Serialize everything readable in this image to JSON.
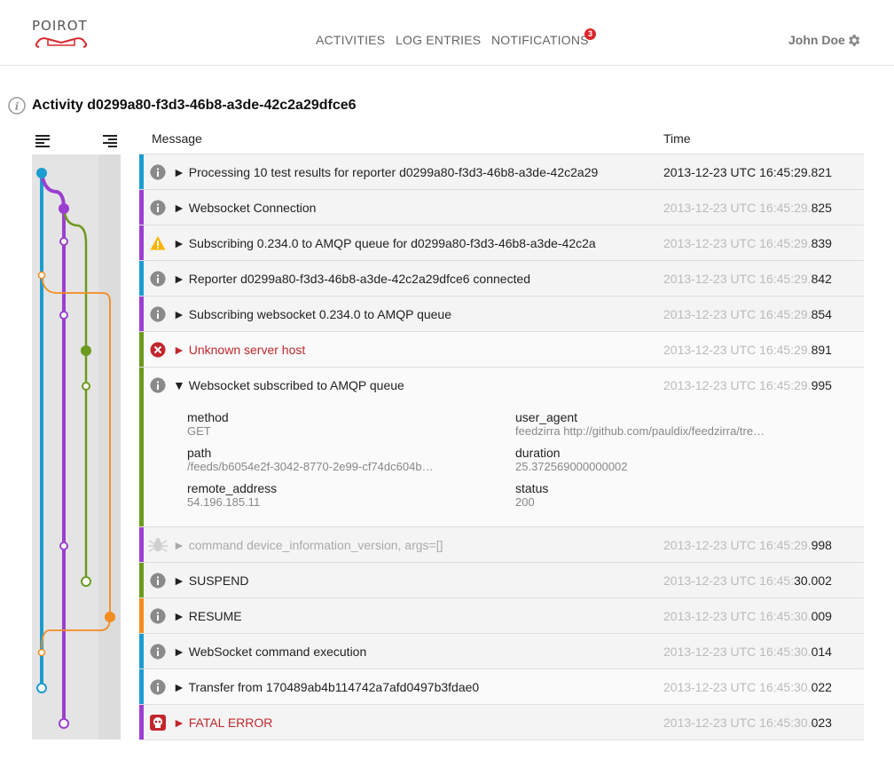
{
  "app": {
    "logo_text": "POIROT"
  },
  "nav": {
    "activities": "ACTIVITIES",
    "log_entries": "LOG ENTRIES",
    "notifications": "NOTIFICATIONS",
    "notifications_count": "3"
  },
  "user": {
    "name": "John Doe"
  },
  "page": {
    "title": "Activity d0299a80-f3d3-46b8-a3de-42c2a29dfce6"
  },
  "table": {
    "col_message": "Message",
    "col_time": "Time"
  },
  "colors": {
    "blue": "#1b9dd0",
    "purple": "#9b3fd0",
    "green": "#6c9a1e",
    "orange": "#f28c1e",
    "error": "#c1272d",
    "warning": "#f7b500"
  },
  "rows": [
    {
      "level": "info",
      "message": "► Processing 10 test results for reporter d0299a80-f3d3-46b8-a3de-42c2a29",
      "time_dim": "",
      "time_bold": "2013-12-23 UTC 16:45:29.821",
      "lane": "blue"
    },
    {
      "level": "info",
      "message": "► Websocket Connection",
      "time_dim": "2013-12-23 UTC 16:45:29.",
      "time_bold": "825",
      "lane": "purple"
    },
    {
      "level": "warning",
      "message": "► Subscribing 0.234.0 to AMQP queue for d0299a80-f3d3-46b8-a3de-42c2a",
      "time_dim": "2013-12-23 UTC 16:45:29.",
      "time_bold": "839",
      "lane": "purple"
    },
    {
      "level": "info",
      "message": "► Reporter d0299a80-f3d3-46b8-a3de-42c2a29dfce6 connected",
      "time_dim": "2013-12-23 UTC 16:45:29.",
      "time_bold": "842",
      "lane": "blue"
    },
    {
      "level": "info",
      "message": "► Subscribing websocket 0.234.0 to AMQP queue",
      "time_dim": "2013-12-23 UTC 16:45:29.",
      "time_bold": "854",
      "lane": "purple"
    },
    {
      "level": "error",
      "message": "► Unknown server host",
      "time_dim": "2013-12-23 UTC 16:45:29.",
      "time_bold": "891",
      "lane": "green"
    },
    {
      "level": "info",
      "message": "▼ Websocket subscribed to AMQP queue",
      "time_dim": "2013-12-23 UTC 16:45:29.",
      "time_bold": "995",
      "lane": "green"
    },
    {
      "level": "debug",
      "message": "► command device_information_version, args=[]",
      "time_dim": "2013-12-23 UTC 16:45:29.",
      "time_bold": "998",
      "lane": "purple"
    },
    {
      "level": "info",
      "message": "► SUSPEND",
      "time_dim": "2013-12-23 UTC 16:45:",
      "time_bold": "30.002",
      "lane": "green"
    },
    {
      "level": "info",
      "message": "► RESUME",
      "time_dim": "2013-12-23 UTC 16:45:30.",
      "time_bold": "009",
      "lane": "orange"
    },
    {
      "level": "info",
      "message": "► WebSocket command execution",
      "time_dim": "2013-12-23 UTC 16:45:30.",
      "time_bold": "014",
      "lane": "blue"
    },
    {
      "level": "info",
      "message": "► Transfer from 170489ab4b114742a7afd0497b3fdae0",
      "time_dim": "2013-12-23 UTC 16:45:30.",
      "time_bold": "022",
      "lane": "blue"
    },
    {
      "level": "fatal",
      "message": "► FATAL ERROR",
      "time_dim": "2013-12-23 UTC 16:45:30.",
      "time_bold": "023",
      "lane": "purple"
    }
  ],
  "details": {
    "method_key": "method",
    "method_val": "GET",
    "user_agent_key": "user_agent",
    "user_agent_val": "feedzirra http://github.com/pauldix/feedzirra/tre…",
    "path_key": "path",
    "path_val": "/feeds/b6054e2f-3042-8770-2e99-cf74dc604b…",
    "duration_key": "duration",
    "duration_val": "25.372569000000002",
    "remote_address_key": "remote_address",
    "remote_address_val": "54.196.185.11",
    "status_key": "status",
    "status_val": "200"
  }
}
